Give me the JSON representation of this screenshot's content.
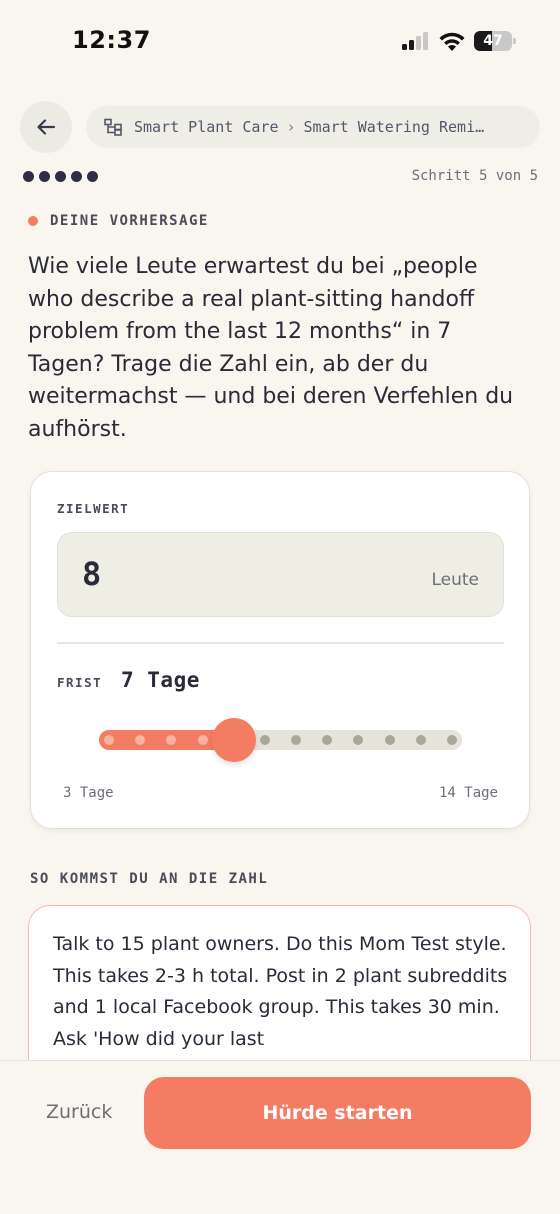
{
  "status_bar": {
    "time": "12:37",
    "battery": "47",
    "battery_level": 0.47
  },
  "nav": {
    "breadcrumb": [
      "Smart Plant Care",
      "Smart Watering Remi…"
    ],
    "separator": "›"
  },
  "progress": {
    "total_steps": 5,
    "current_step": 5,
    "label": "Schritt 5 von 5"
  },
  "prediction": {
    "section_label": "DEINE VORHERSAGE",
    "question": "Wie viele Leute erwartest du bei „people who describe a real plant-sitting handoff problem from the last 12 months“ in 7 Tagen? Trage die Zahl ein, ab der du weitermachst — und bei deren Verfehlen du aufhörst."
  },
  "target": {
    "label": "ZIELWERT",
    "value": "8",
    "unit": "Leute"
  },
  "deadline": {
    "label": "FRIST",
    "value": "7 Tage",
    "slider": {
      "min": 3,
      "max": 14,
      "value": 7
    },
    "min_label": "3 Tage",
    "max_label": "14 Tage"
  },
  "how_to": {
    "label": "SO KOMMST DU AN DIE ZAHL",
    "text": "Talk to 15 plant owners. Do this Mom Test style. This takes 2-3 h total. Post in 2 plant subreddits and 1 local Facebook group. This takes 30 min. Ask 'How did your last"
  },
  "footer": {
    "back_label": "Zurück",
    "start_label": "Hürde starten"
  },
  "colors": {
    "accent": "#f47c62",
    "dark": "#2d2d45",
    "background": "#f8f6ee",
    "track": "#e6e4da"
  }
}
